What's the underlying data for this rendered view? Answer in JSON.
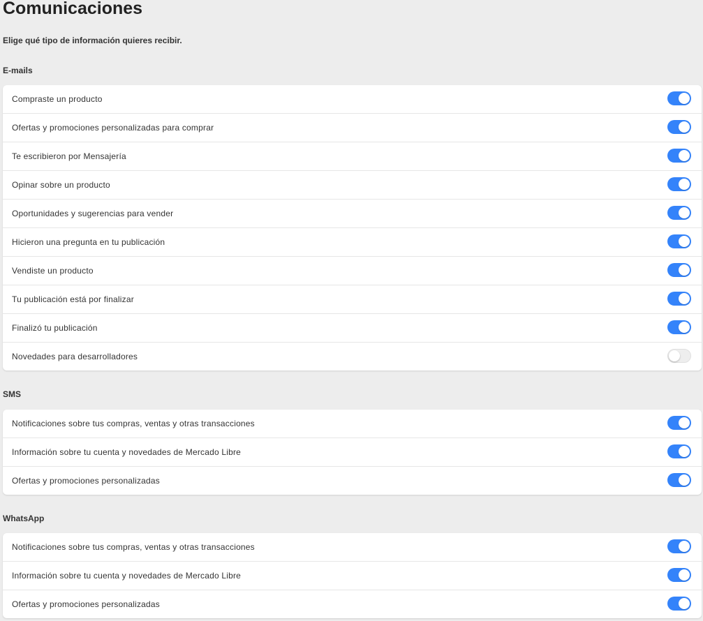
{
  "page": {
    "title": "Comunicaciones",
    "subtitle": "Elige qué tipo de información quieres recibir."
  },
  "colors": {
    "toggle_on": "#3483fa",
    "toggle_off": "#eeeeee",
    "background": "#ededed"
  },
  "sections": {
    "email": {
      "title": "E-mails",
      "items": [
        {
          "label": "Compraste un producto",
          "enabled": true
        },
        {
          "label": "Ofertas y promociones personalizadas para comprar",
          "enabled": true
        },
        {
          "label": "Te escribieron por Mensajería",
          "enabled": true
        },
        {
          "label": "Opinar sobre un producto",
          "enabled": true
        },
        {
          "label": "Oportunidades y sugerencias para vender",
          "enabled": true
        },
        {
          "label": "Hicieron una pregunta en tu publicación",
          "enabled": true
        },
        {
          "label": "Vendiste un producto",
          "enabled": true
        },
        {
          "label": "Tu publicación está por finalizar",
          "enabled": true
        },
        {
          "label": "Finalizó tu publicación",
          "enabled": true
        },
        {
          "label": "Novedades para desarrolladores",
          "enabled": false
        }
      ]
    },
    "sms": {
      "title": "SMS",
      "items": [
        {
          "label": "Notificaciones sobre tus compras, ventas y otras transacciones",
          "enabled": true
        },
        {
          "label": "Información sobre tu cuenta y novedades de Mercado Libre",
          "enabled": true
        },
        {
          "label": "Ofertas y promociones personalizadas",
          "enabled": true
        }
      ]
    },
    "whatsapp": {
      "title": "WhatsApp",
      "items": [
        {
          "label": "Notificaciones sobre tus compras, ventas y otras transacciones",
          "enabled": true
        },
        {
          "label": "Información sobre tu cuenta y novedades de Mercado Libre",
          "enabled": true
        },
        {
          "label": "Ofertas y promociones personalizadas",
          "enabled": true
        }
      ]
    }
  }
}
